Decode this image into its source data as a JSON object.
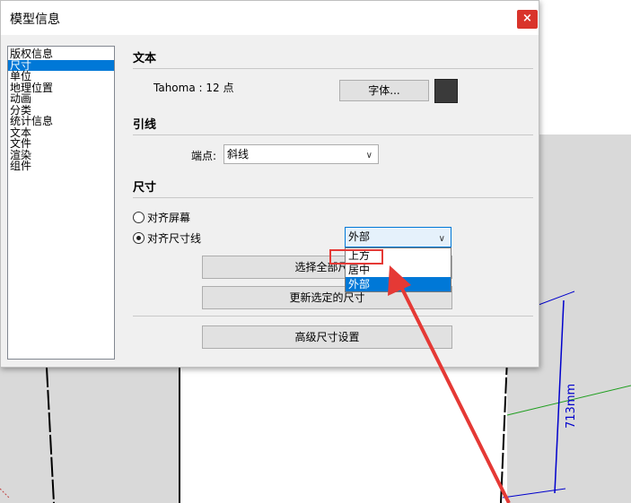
{
  "dialog": {
    "title": "模型信息",
    "close_label": "×",
    "nav": {
      "items": [
        "版权信息",
        "尺寸",
        "单位",
        "地理位置",
        "动画",
        "分类",
        "统计信息",
        "文本",
        "文件",
        "渲染",
        "组件"
      ],
      "selected_index": 1
    },
    "text_section": {
      "title": "文本",
      "font_info": "Tahoma : 12 点",
      "font_button": "字体...",
      "color_swatch": "#3a3a3a"
    },
    "leader_section": {
      "title": "引线",
      "endpoint_label": "端点:",
      "endpoint_value": "斜线"
    },
    "dimension_section": {
      "title": "尺寸",
      "radio_screen": "对齐屏幕",
      "radio_dimline": "对齐尺寸线",
      "radio_dimline_checked": true,
      "align_value": "外部",
      "dropdown_options": [
        "上方",
        "居中",
        "外部"
      ],
      "dropdown_selected_index": 2,
      "select_all_button": "选择全部尺寸",
      "update_selected_button": "更新选定的尺寸",
      "advanced_button": "高级尺寸设置"
    }
  },
  "scene": {
    "dimension_label": "713mm"
  },
  "colors": {
    "accent": "#0078d7",
    "close_button": "#d9342b",
    "annotation_red": "#e53935"
  }
}
